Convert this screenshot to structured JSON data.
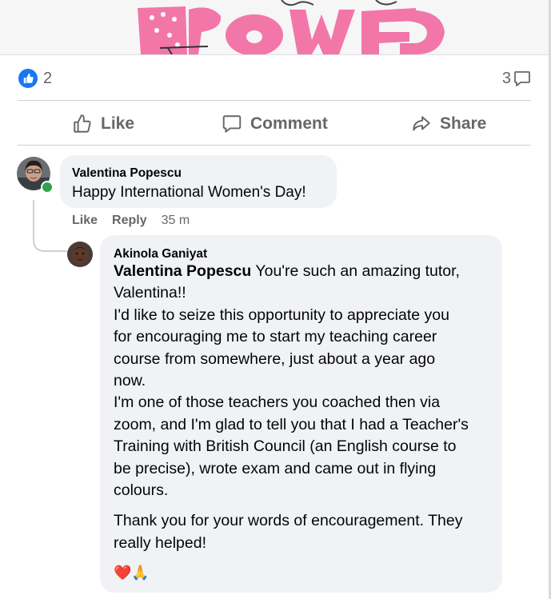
{
  "post": {
    "like_count": "2",
    "comment_count": "3"
  },
  "actions": {
    "like_label": "Like",
    "comment_label": "Comment",
    "share_label": "Share"
  },
  "comments": [
    {
      "author": "Valentina Popescu",
      "text": "Happy International Women's Day!",
      "like_label": "Like",
      "reply_label": "Reply",
      "time": "35 m",
      "online": true
    }
  ],
  "reply": {
    "author": "Akinola Ganiyat",
    "mention": "Valentina Popescu",
    "line1_rest": " You're such an amazing tutor,",
    "line2": "Valentina!!",
    "line3": "I'd like to seize this opportunity to appreciate you",
    "line4": "for encouraging me to start my teaching career",
    "line5": "course from somewhere, just about a year ago",
    "line6": "now.",
    "line7": "I'm one of those teachers you coached then via",
    "line8": "zoom, and I'm glad to tell you that I had a Teacher's",
    "line9": "Training with British Council (an English course to",
    "line10": "be precise), wrote exam and came out in flying",
    "line11": "colours.",
    "line12": "Thank you for your words of encouragement. They",
    "line13": "really helped!",
    "emojis": "❤️🙏"
  },
  "colors": {
    "facebook_blue": "#1877f2",
    "meta_gray": "#65676b",
    "bubble_bg": "#f0f2f5",
    "online_green": "#31a24c",
    "banner_pink": "#f277a8"
  },
  "icons": {
    "like_badge": "thumbs-up-icon",
    "comment_count": "speech-bubble-icon",
    "like_action": "thumbs-up-outline-icon",
    "comment_action": "comment-outline-icon",
    "share_action": "share-arrow-icon"
  }
}
